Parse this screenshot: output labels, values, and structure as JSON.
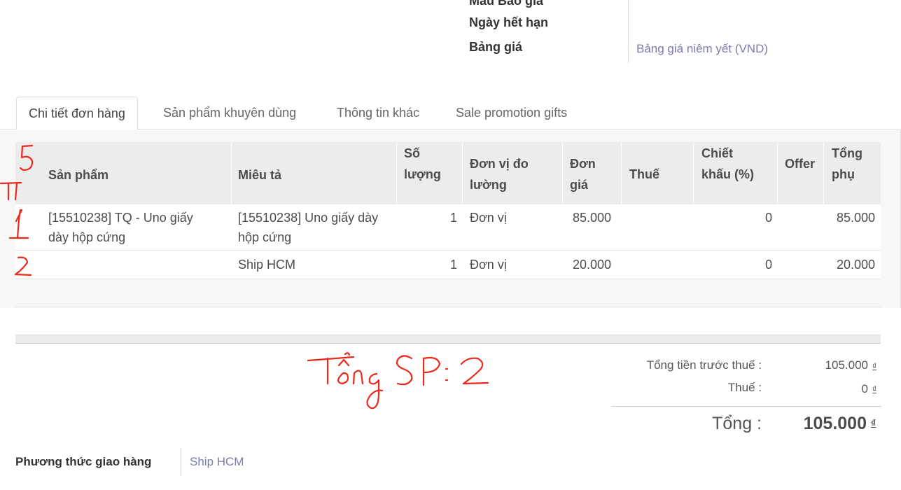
{
  "header_fields": {
    "quotation_template_label": "Mẫu Báo giá",
    "expiration_label": "Ngày hết hạn",
    "pricelist_label": "Bảng giá",
    "pricelist_value": "Bảng giá niêm yết (VND)"
  },
  "tabs": [
    {
      "label": "Chi tiết đơn hàng"
    },
    {
      "label": "Sản phẩm khuyên dùng"
    },
    {
      "label": "Thông tin khác"
    },
    {
      "label": "Sale promotion gifts"
    }
  ],
  "table": {
    "columns": {
      "product": "Sản phẩm",
      "description": "Miêu tả",
      "qty_1": "Số",
      "qty_2": "lượng",
      "uom_1": "Đơn vị đo",
      "uom_2": "lường",
      "price_1": "Đơn",
      "price_2": "giá",
      "tax": "Thuế",
      "disc_1": "Chiết",
      "disc_2": "khấu (%)",
      "offer": "Offer",
      "subtotal_1": "Tổng",
      "subtotal_2": "phụ"
    },
    "rows": [
      {
        "product_1": "[15510238] TQ - Uno giấy",
        "product_2": "dày hộp cứng",
        "description_1": "[15510238] Uno giấy dày",
        "description_2": "hộp cứng",
        "qty": "1",
        "uom": "Đơn vị",
        "price": "85.000",
        "discount": "0",
        "subtotal": "85.000"
      },
      {
        "product_1": "",
        "product_2": "",
        "description_1": "Ship HCM",
        "description_2": "",
        "qty": "1",
        "uom": "Đơn vị",
        "price": "20.000",
        "discount": "0",
        "subtotal": "20.000"
      }
    ]
  },
  "totals": {
    "untaxed_label": "Tổng tiền trước thuế :",
    "untaxed_value": "105.000",
    "tax_label": "Thuế :",
    "tax_value": "0",
    "total_label": "Tổng :",
    "total_value": "105.000",
    "currency": "₫"
  },
  "delivery": {
    "label": "Phương thức giao hàng",
    "value": "Ship HCM"
  },
  "annotations": {
    "header_note": "5",
    "header_note_2": "TT",
    "row1_note": "1",
    "row2_note": "2",
    "total_note": "Tổng SP: 2",
    "ink_color": "#e8291c"
  }
}
